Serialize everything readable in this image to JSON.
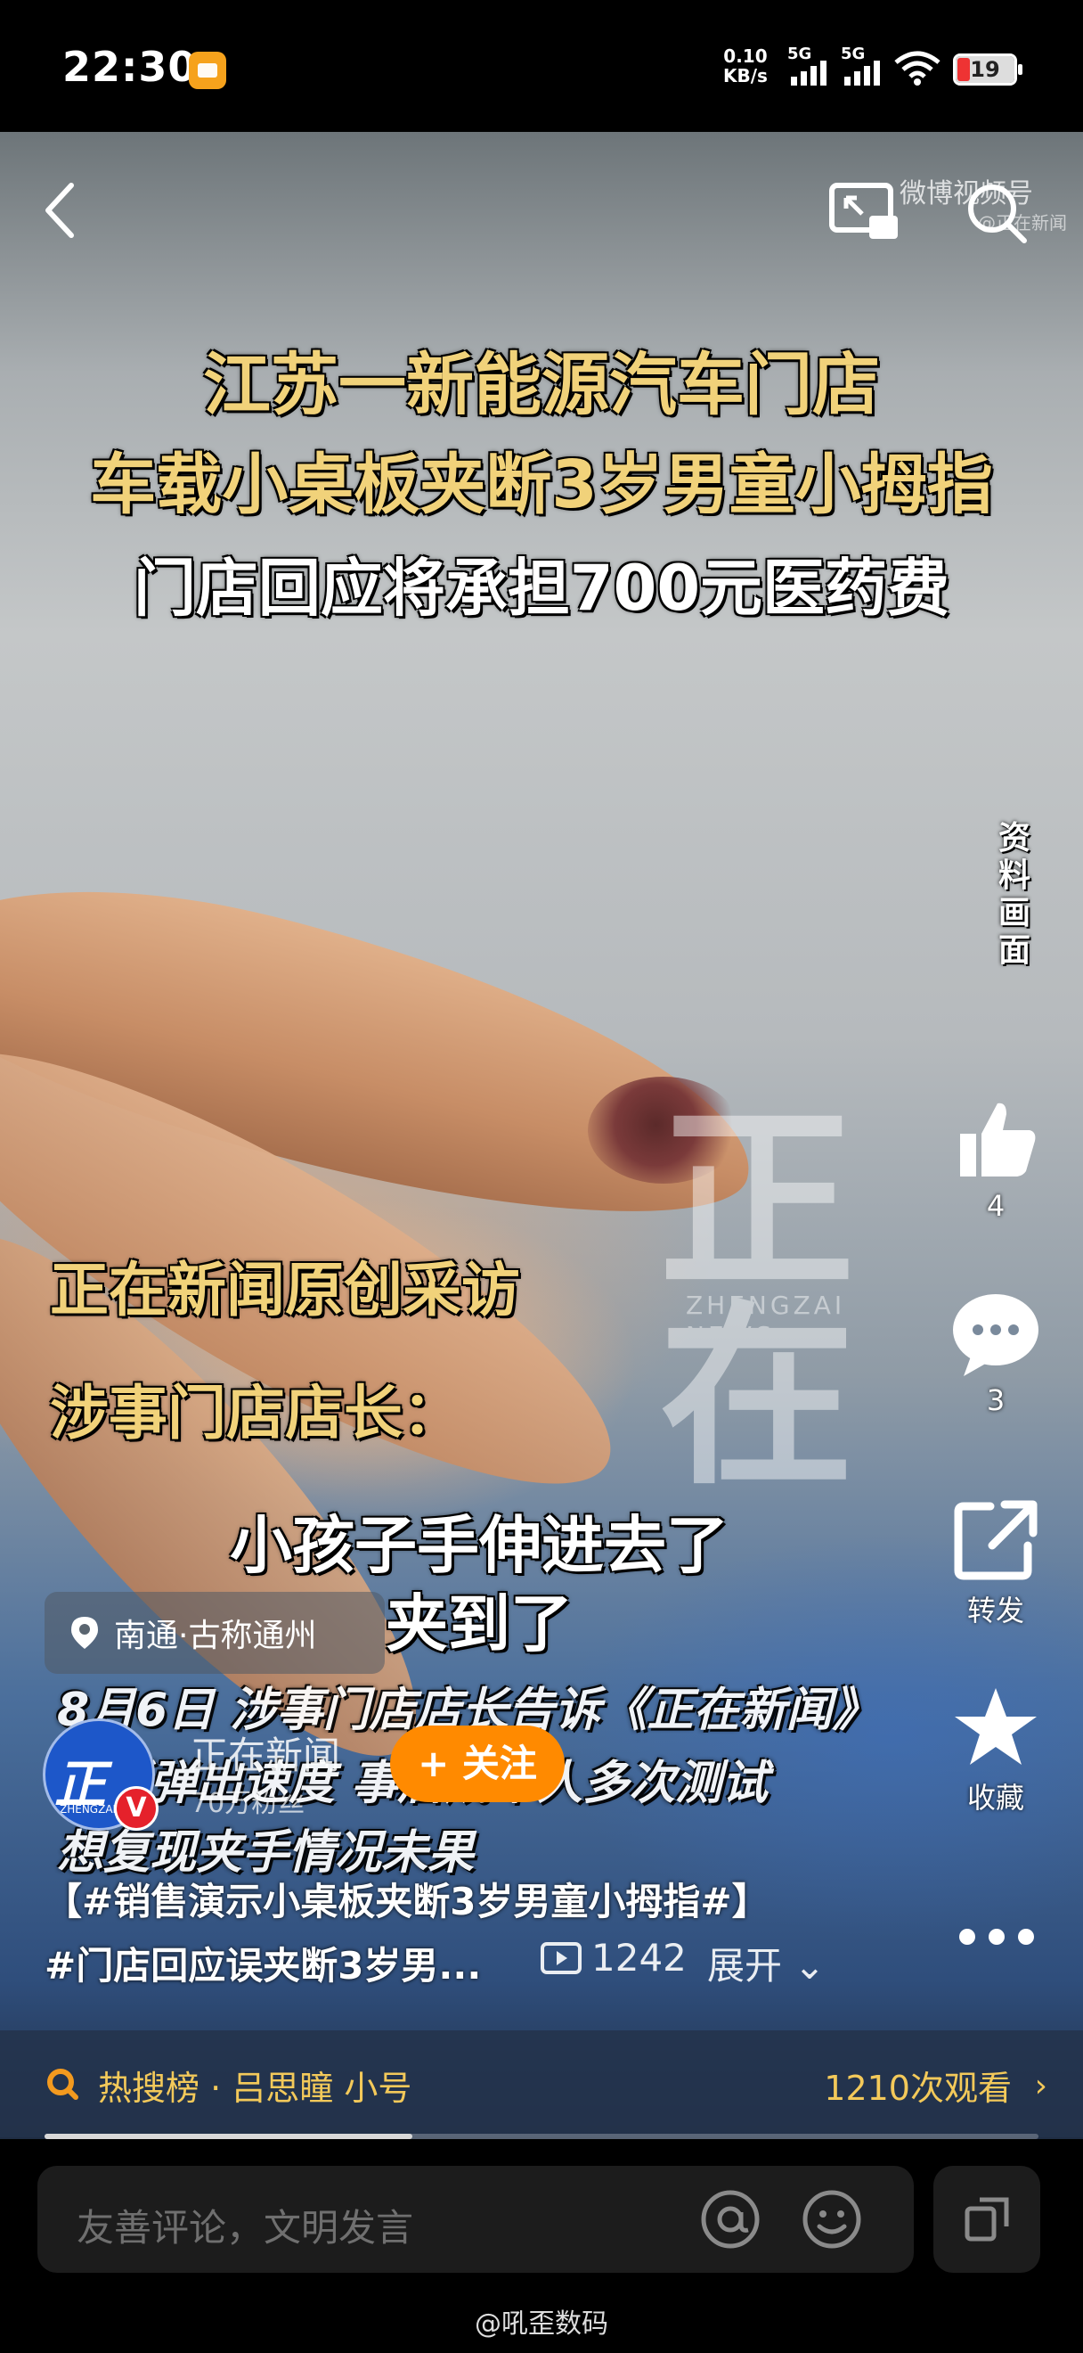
{
  "status": {
    "time": "22:30",
    "net_speed_top": "0.10",
    "net_speed_bottom": "KB/s",
    "signal1": "5G",
    "signal2": "5G",
    "battery": "19"
  },
  "nav": {
    "source": "微博视频号",
    "source_sub": "@正在新闻"
  },
  "video": {
    "headline_1": "江苏一新能源汽车门店",
    "headline_2": "车载小桌板夹断3岁男童小拇指",
    "headline_3": "门店回应将承担700元医药费",
    "side_tag": "资料画面",
    "watermark": "正在",
    "watermark_sub_1": "ZHENGZAI",
    "watermark_sub_2": "NEWS",
    "interview_1": "正在新闻原创采访",
    "interview_2": "涉事门店店长：",
    "quote_1": "小孩子手伸进去了",
    "quote_2": "夹到了",
    "caption_1": "8月6日 涉事门店店长告诉《正在新闻》",
    "caption_2": "桌板弹出速度 事后成年人多次测试",
    "caption_3": "想复现夹手情况未果"
  },
  "actions": {
    "likes": "4",
    "comments": "3",
    "share": "转发",
    "favorite": "收藏"
  },
  "location": "南通·古称通州",
  "author": {
    "avatar_text": "正在",
    "avatar_sub": "ZHENGZAI NEWS",
    "name": "正在新闻",
    "fans": "70万粉丝",
    "follow": "+ 关注"
  },
  "post": {
    "line_1": "【#销售演示小桌板夹断3岁男童小拇指#】",
    "line_2": "#门店回应误夹断3岁男...",
    "plays": "1242",
    "expand": "展开"
  },
  "hot": {
    "label": "热搜榜 · 吕思瞳 小号",
    "views": "1210次观看",
    "chevron": "›"
  },
  "progress": 0.37,
  "comment": {
    "placeholder": "友善评论，文明发言"
  },
  "credit": "@吼歪数码"
}
